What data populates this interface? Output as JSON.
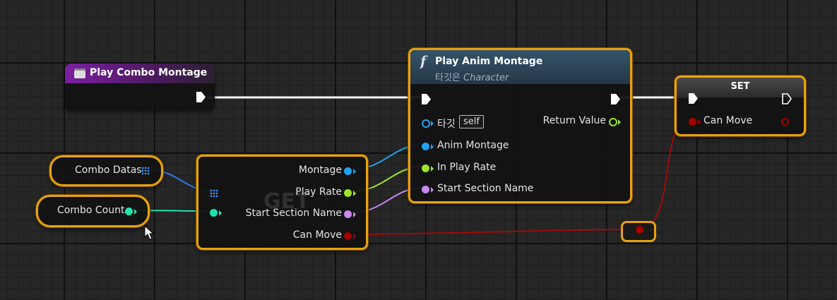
{
  "event_node": {
    "title": "Play Combo Montage"
  },
  "montage_node": {
    "title": "Play Anim Montage",
    "subtitle_prefix": "타깃은",
    "subtitle_class": "Character",
    "func_glyph": "f",
    "pins": {
      "target": "타깃",
      "target_default": "self",
      "anim_montage": "Anim Montage",
      "in_play_rate": "In Play Rate",
      "start_section_name": "Start Section Name",
      "return_value": "Return Value"
    }
  },
  "set_node": {
    "title": "SET",
    "pin": "Can Move"
  },
  "get_node": {
    "watermark": "GET",
    "pins": {
      "montage": "Montage",
      "play_rate": "Play Rate",
      "start_section_name": "Start Section Name",
      "can_move": "Can Move"
    }
  },
  "vars": {
    "combo_datas": "Combo Datas",
    "combo_count": "Combo Count"
  },
  "colors": {
    "exec": "#ffffff",
    "object": "#1ea3f0",
    "float": "#9be62d",
    "name": "#c889f2",
    "bool": "#a30000",
    "int": "#1fe3ae",
    "struct": "#2e78e8",
    "selection": "#e8a20f",
    "event_header": "#7a1fa0",
    "function_header": "#2f4f66"
  }
}
